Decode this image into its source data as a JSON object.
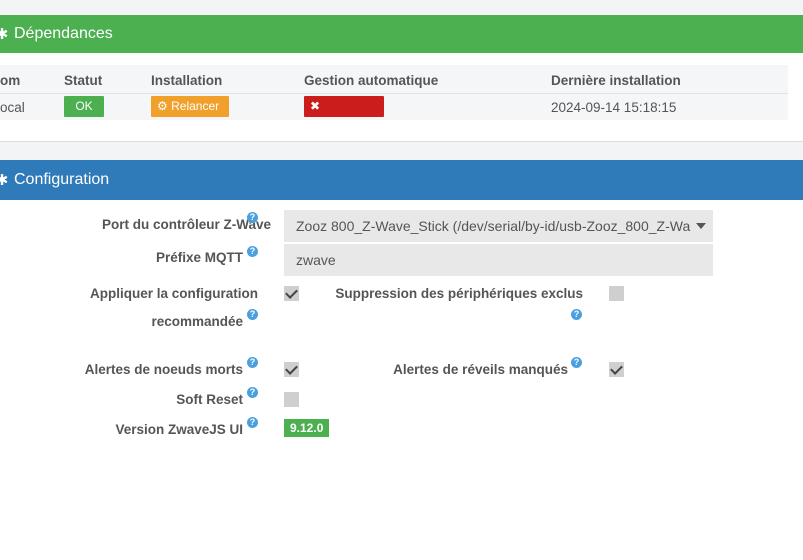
{
  "dependencies": {
    "title": "Dépendances",
    "columns": [
      "om",
      "Statut",
      "Installation",
      "Gestion automatique",
      "Dernière installation"
    ],
    "row": {
      "name": "ocal",
      "status": "OK",
      "install_action": "Relancer",
      "auto_action": "Désactiver",
      "last_install": "2024-09-14 15:18:15"
    }
  },
  "configuration": {
    "title": "Configuration",
    "port": {
      "label": "Port du contrôleur Z-Wave",
      "value": "Zooz 800_Z-Wave_Stick (/dev/serial/by-id/usb-Zooz_800_Z-Wa"
    },
    "mqtt": {
      "label": "Préfixe MQTT",
      "value": "zwave"
    },
    "apply_config": {
      "label_line1": "Appliquer la configuration",
      "label_line2": "recommandée",
      "checked": true
    },
    "remove_excluded": {
      "label": "Suppression des périphériques exclus",
      "checked": false
    },
    "dead_node_alerts": {
      "label": "Alertes de noeuds morts",
      "checked": true
    },
    "missed_wakeup_alerts": {
      "label": "Alertes de réveils manqués",
      "checked": true
    },
    "soft_reset": {
      "label": "Soft Reset",
      "checked": false
    },
    "zwavejs_version": {
      "label": "Version ZwaveJS UI",
      "value": "9.12.0"
    }
  },
  "colors": {
    "success": "#4caf50",
    "warning": "#f0a02b",
    "danger": "#cc1d1d",
    "primary": "#2f7ab9",
    "help": "#4aa0de"
  }
}
